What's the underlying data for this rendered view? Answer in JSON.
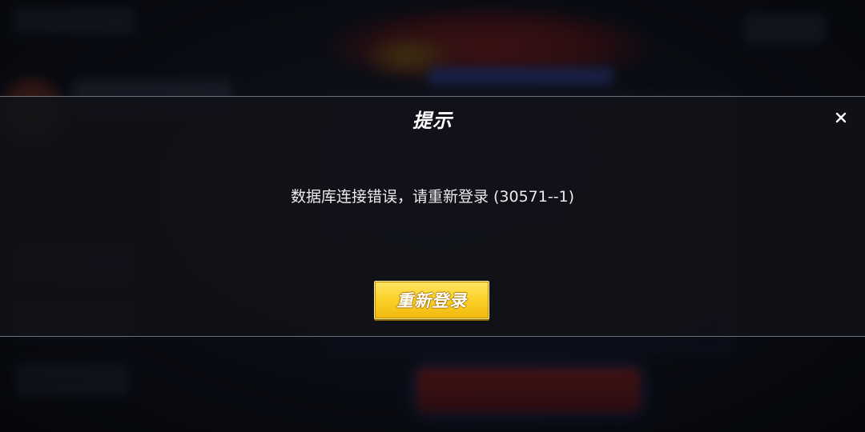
{
  "dialog": {
    "title": "提示",
    "message": "数据库连接错误，请重新登录 (30571--1)",
    "primary_button_label": "重新登录",
    "close_icon": "close-icon"
  },
  "colors": {
    "button_gold": "#fcd22c",
    "dialog_bg": "#121318",
    "text": "#ffffff"
  }
}
